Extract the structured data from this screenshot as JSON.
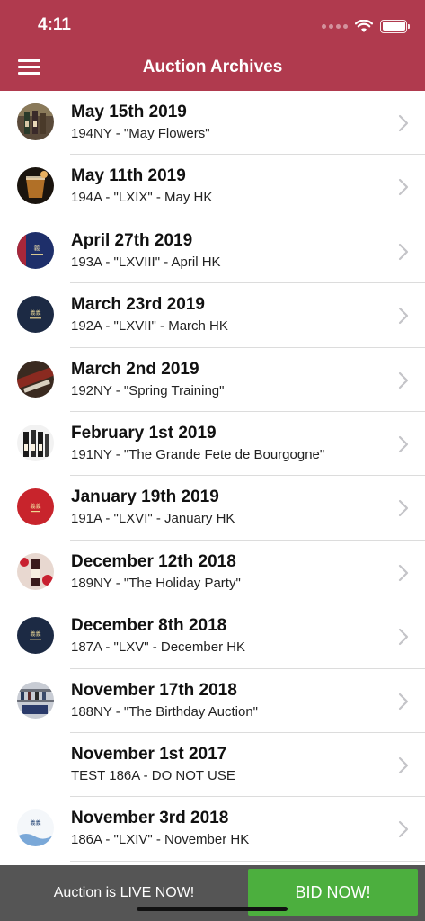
{
  "status": {
    "time": "4:11"
  },
  "header": {
    "title": "Auction Archives"
  },
  "auctions": [
    {
      "date": "May 15th 2019",
      "subtitle": "194NY - \"May Flowers\"",
      "thumb": "wine-bottles-photo"
    },
    {
      "date": "May 11th 2019",
      "subtitle": "194A - \"LXIX\" - May HK",
      "thumb": "whiskey-glass-photo"
    },
    {
      "date": "April 27th 2019",
      "subtitle": "193A - \"LXVIII\" - April HK",
      "thumb": "blue-catalog-cover"
    },
    {
      "date": "March 23rd 2019",
      "subtitle": "192A - \"LXVII\" - March HK",
      "thumb": "navy-catalog-cover"
    },
    {
      "date": "March 2nd 2019",
      "subtitle": "192NY - \"Spring Training\"",
      "thumb": "wine-cellar-photo"
    },
    {
      "date": "February 1st 2019",
      "subtitle": "191NY - \"The Grande Fete de Bourgogne\"",
      "thumb": "burgundy-bottles-photo"
    },
    {
      "date": "January 19th 2019",
      "subtitle": "191A - \"LXVI\" - January HK",
      "thumb": "red-catalog-cover"
    },
    {
      "date": "December 12th 2018",
      "subtitle": "189NY - \"The Holiday Party\"",
      "thumb": "holiday-bottle-photo"
    },
    {
      "date": "December 8th 2018",
      "subtitle": "187A - \"LXV\" - December HK",
      "thumb": "navy-catalog-cover"
    },
    {
      "date": "November 17th 2018",
      "subtitle": "188NY - \"The Birthday Auction\"",
      "thumb": "cellar-shelves-photo"
    },
    {
      "date": "November 1st 2017",
      "subtitle": "TEST 186A - DO NOT USE",
      "thumb": ""
    },
    {
      "date": "November 3rd 2018",
      "subtitle": "186A - \"LXIV\" - November HK",
      "thumb": "white-catalog-cover"
    }
  ],
  "footer": {
    "live_text": "Auction is LIVE NOW!",
    "bid_label": "BID NOW!"
  },
  "colors": {
    "header": "#b03a4e",
    "bid_button": "#4caf3e",
    "footer": "#555555"
  }
}
